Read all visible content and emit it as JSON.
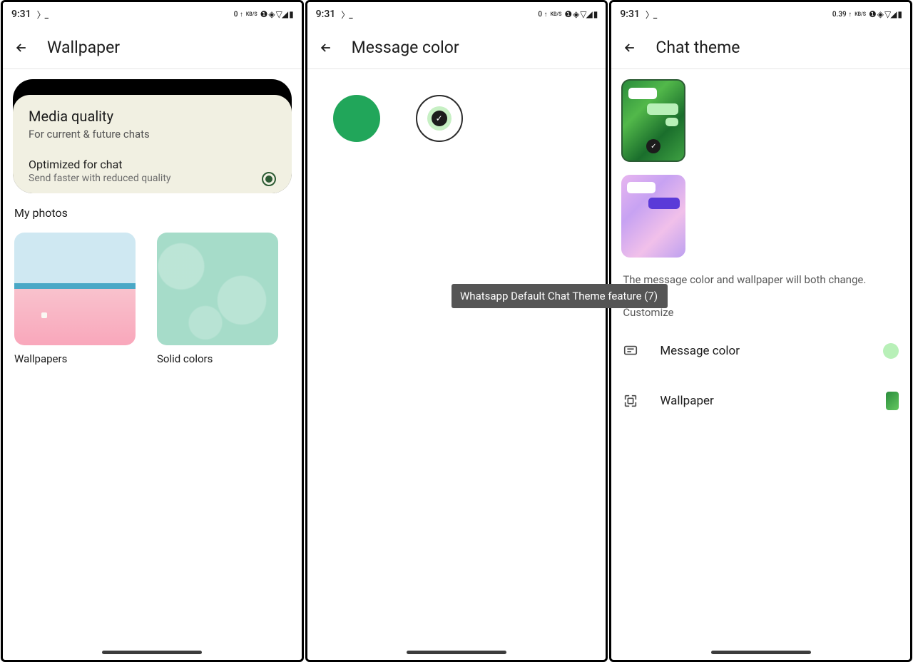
{
  "status": {
    "time12": "9:31",
    "time3": "9:31",
    "net12": "0 ↑",
    "net3": "0.39 ↑",
    "kbs": "KB/S"
  },
  "screen1": {
    "title": "Wallpaper",
    "media_title": "Media quality",
    "media_sub": "For current & future chats",
    "opt_title": "Optimized for chat",
    "opt_sub": "Send faster with reduced quality",
    "my_photos": "My photos",
    "wallpapers": "Wallpapers",
    "solid": "Solid colors"
  },
  "screen2": {
    "title": "Message color",
    "colors": {
      "green": "#21a65a",
      "light": "#c7f0c4"
    }
  },
  "screen3": {
    "title": "Chat theme",
    "info": "The message color and wallpaper will both change.",
    "customize": "Customize",
    "msg_color": "Message color",
    "wallpaper": "Wallpaper",
    "swatch_color": "#b8f0b8"
  },
  "tooltip": "Whatsapp Default Chat Theme feature (7)"
}
